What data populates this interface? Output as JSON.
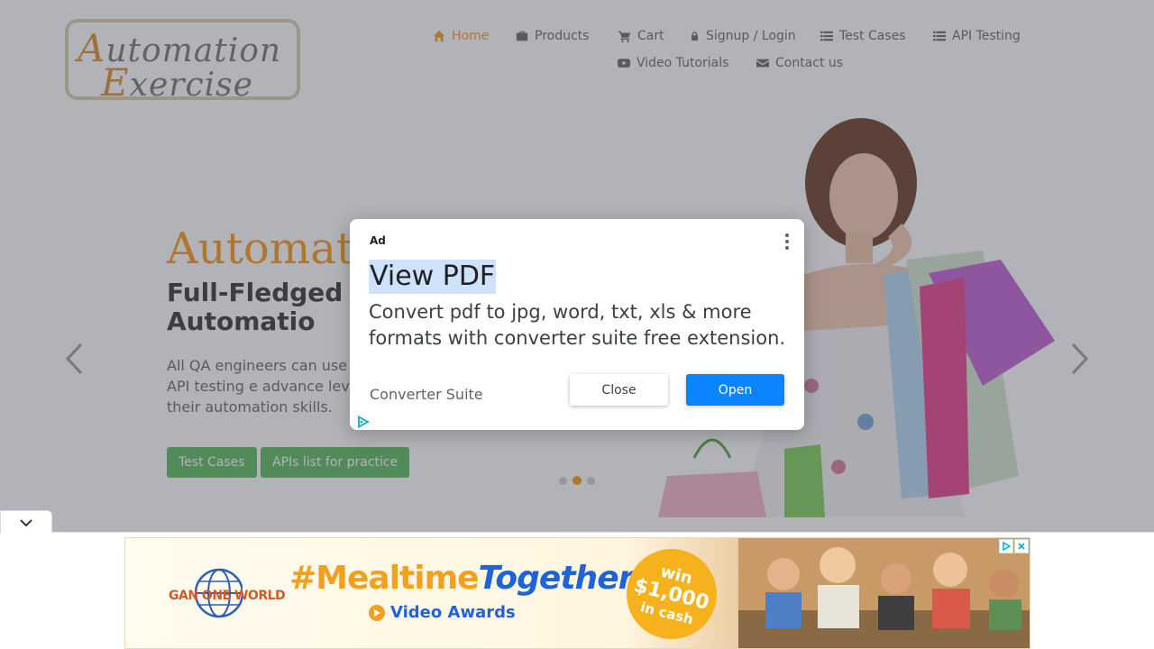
{
  "header": {
    "logo_line1_cap": "A",
    "logo_line1_rest": "utomation",
    "logo_line2_cap": "E",
    "logo_line2_rest": "xercise",
    "nav": [
      {
        "label": "Home",
        "icon": "home-icon"
      },
      {
        "label": "Products",
        "icon": "briefcase-icon"
      },
      {
        "label": "Cart",
        "icon": "cart-icon"
      },
      {
        "label": "Signup / Login",
        "icon": "lock-icon"
      },
      {
        "label": "Test Cases",
        "icon": "list-icon"
      },
      {
        "label": "API Testing",
        "icon": "list-icon"
      },
      {
        "label": "Video Tutorials",
        "icon": "youtube-icon"
      },
      {
        "label": "Contact us",
        "icon": "envelope-icon"
      }
    ]
  },
  "hero": {
    "title": "Automat",
    "subtitle": "Full-Fledged for Automatio",
    "text": "All QA engineers can use practice and API testing e advance level. This is for their automation skills.",
    "btn_test_cases": "Test Cases",
    "btn_apis": "APIs list for practice",
    "slides": 3,
    "active_slide": 2
  },
  "ad_dialog": {
    "label": "Ad",
    "title": "View PDF",
    "description": "Convert pdf to jpg, word, txt, xls & more formats with converter suite free extension.",
    "brand": "Converter Suite",
    "close_label": "Close",
    "open_label": "Open"
  },
  "bottom_banner": {
    "logo_text": "GAN ONE WORLD",
    "hashtag_part1": "#Mealtime",
    "hashtag_part2": "Together",
    "subtitle": "Video Awards",
    "badge_line1": "win",
    "badge_line2": "$1,000",
    "badge_line3": "in cash"
  },
  "colors": {
    "accent": "#fe980f",
    "green": "#5cb85c",
    "ad_open": "#0b84ff"
  }
}
